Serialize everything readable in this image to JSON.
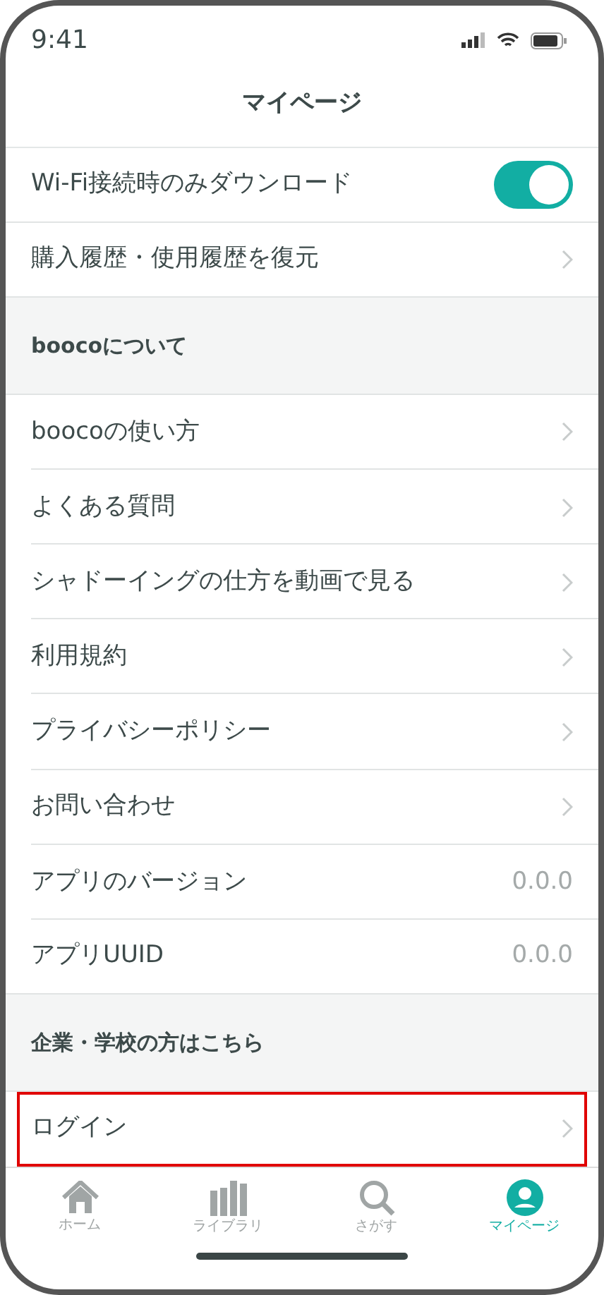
{
  "status_bar": {
    "time": "9:41"
  },
  "header": {
    "title": "マイページ"
  },
  "rows": [
    {
      "kind": "toggle",
      "label": "Wi-Fi接続時のみダウンロード",
      "on": true
    },
    {
      "kind": "link",
      "label": "購入履歴・使用履歴を復元"
    },
    {
      "kind": "header",
      "label": "boocoについて"
    },
    {
      "kind": "link",
      "label": "boocoの使い方"
    },
    {
      "kind": "link",
      "label": "よくある質問"
    },
    {
      "kind": "link",
      "label": "シャドーイングの仕方を動画で見る"
    },
    {
      "kind": "link",
      "label": "利用規約"
    },
    {
      "kind": "link",
      "label": "プライバシーポリシー"
    },
    {
      "kind": "link",
      "label": "お問い合わせ"
    },
    {
      "kind": "value",
      "label": "アプリのバージョン",
      "value": "0.0.0"
    },
    {
      "kind": "value",
      "label": "アプリUUID",
      "value": "0.0.0"
    },
    {
      "kind": "header",
      "label": "企業・学校の方はこちら"
    },
    {
      "kind": "link",
      "label": "ログイン",
      "highlighted": true
    }
  ],
  "tab_bar": [
    {
      "kind": "home",
      "label": "ホーム",
      "selected": false
    },
    {
      "kind": "library",
      "label": "ライブラリ",
      "selected": false
    },
    {
      "kind": "search",
      "label": "さがす",
      "selected": false
    },
    {
      "kind": "profile",
      "label": "マイページ",
      "selected": true
    }
  ]
}
